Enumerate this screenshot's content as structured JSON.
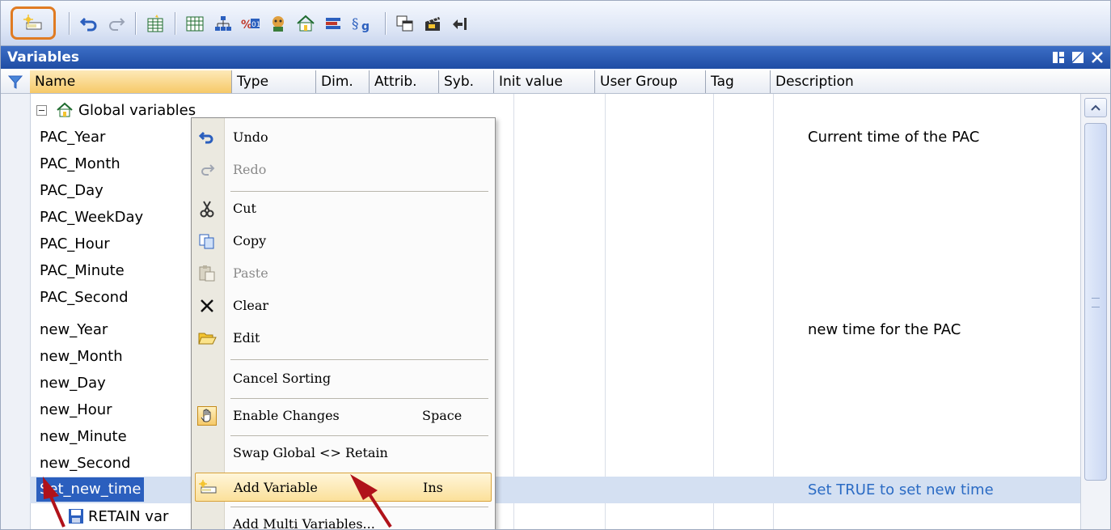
{
  "panel": {
    "title": "Variables"
  },
  "columns": [
    "Name",
    "Type",
    "Dim.",
    "Attrib.",
    "Syb.",
    "Init value",
    "User Group",
    "Tag",
    "Description"
  ],
  "group_label": "Global variables",
  "rows": [
    {
      "name": "PAC_Year",
      "description": "Current time of the PAC"
    },
    {
      "name": "PAC_Month",
      "description": ""
    },
    {
      "name": "PAC_Day",
      "description": ""
    },
    {
      "name": "PAC_WeekDay",
      "description": ""
    },
    {
      "name": "PAC_Hour",
      "description": ""
    },
    {
      "name": "PAC_Minute",
      "description": ""
    },
    {
      "name": "PAC_Second",
      "description": ""
    },
    {
      "name": "new_Year",
      "description": "new time for the PAC"
    },
    {
      "name": "new_Month",
      "description": ""
    },
    {
      "name": "new_Day",
      "description": ""
    },
    {
      "name": "new_Hour",
      "description": ""
    },
    {
      "name": "new_Minute",
      "description": ""
    },
    {
      "name": "new_Second",
      "description": ""
    },
    {
      "name": "Set_new_time",
      "description": "Set TRUE to set new time"
    }
  ],
  "retain_label": "RETAIN var",
  "menu": {
    "undo": "Undo",
    "redo": "Redo",
    "cut": "Cut",
    "copy": "Copy",
    "paste": "Paste",
    "clear": "Clear",
    "edit": "Edit",
    "cancel_sorting": "Cancel Sorting",
    "enable_changes": "Enable Changes",
    "enable_changes_shortcut": "Space",
    "swap": "Swap Global <> Retain",
    "add_variable": "Add Variable",
    "add_variable_shortcut": "Ins",
    "add_multi": "Add Multi Variables..."
  },
  "toolbar_icons": [
    "add-variable-icon",
    "undo-icon",
    "redo-icon",
    "table-icon",
    "grid-icon",
    "tree-icon",
    "binary-icon",
    "person-icon",
    "home-icon",
    "flag-icon",
    "symbol-icon",
    "window-icon",
    "clapper-icon",
    "import-icon"
  ],
  "colors": {
    "accent": "#e07b22",
    "title_bar": "#2a5bb5",
    "selection": "#2b5fbe",
    "arrow": "#b0121a"
  }
}
